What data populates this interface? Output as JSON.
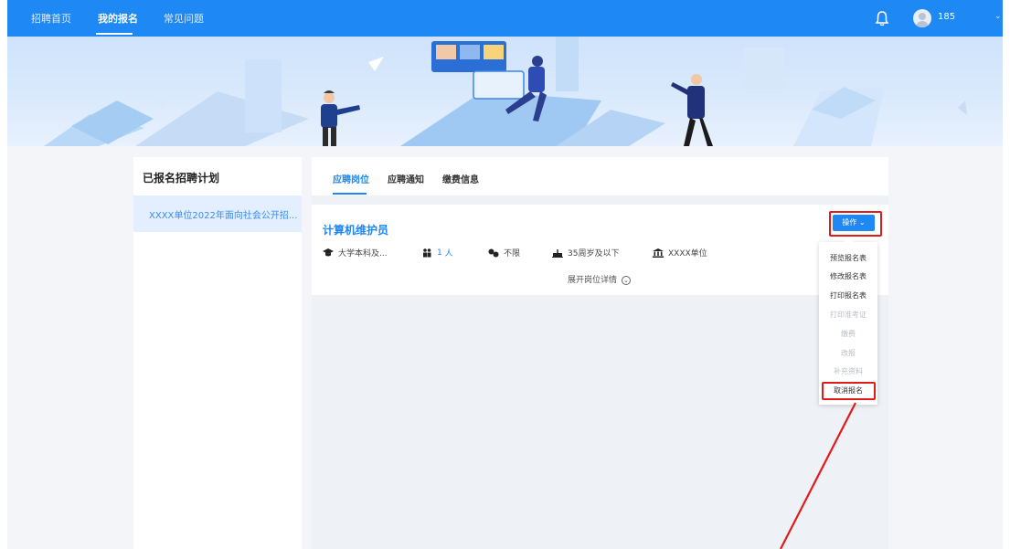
{
  "nav": {
    "items": [
      {
        "label": "招聘首页"
      },
      {
        "label": "我的报名"
      },
      {
        "label": "常见问题"
      }
    ],
    "username": "185"
  },
  "sidebar": {
    "title": "已报名招聘计划",
    "items": [
      {
        "label": "XXXX单位2022年面向社会公开招..."
      }
    ]
  },
  "tabs": [
    {
      "label": "应聘岗位"
    },
    {
      "label": "应聘通知"
    },
    {
      "label": "缴费信息"
    }
  ],
  "job": {
    "title": "计算机维护员",
    "education": "大学本科及...",
    "headcount": "1",
    "headcount_unit": "人",
    "gender": "不限",
    "age": "35周岁及以下",
    "unit": "XXXX单位",
    "expand_label": "展开岗位详情"
  },
  "actions": {
    "button_label": "操作",
    "menu": [
      {
        "label": "预览报名表",
        "enabled": true
      },
      {
        "label": "修改报名表",
        "enabled": true
      },
      {
        "label": "打印报名表",
        "enabled": true
      },
      {
        "label": "打印准考证",
        "enabled": false
      },
      {
        "label": "缴费",
        "enabled": false
      },
      {
        "label": "改报",
        "enabled": false
      },
      {
        "label": "补充资料",
        "enabled": false
      },
      {
        "label": "取消报名",
        "enabled": true
      }
    ]
  },
  "colors": {
    "primary": "#1e88f5",
    "highlight": "#e11a1a",
    "disabled": "#b9bec6"
  }
}
